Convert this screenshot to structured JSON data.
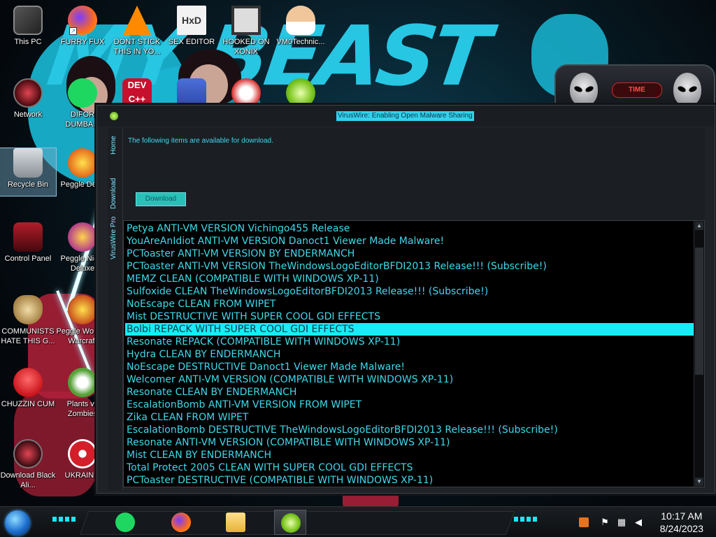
{
  "desktop": {
    "icons": [
      {
        "label": "This PC"
      },
      {
        "label": "FURRY FUX"
      },
      {
        "label": "DONT STICK THIS IN YO..."
      },
      {
        "label": "SEX EDITOR",
        "glyph": "HxD"
      },
      {
        "label": "HOOKED ON XONIX"
      },
      {
        "label": "VM0Technic..."
      },
      {
        "label": "Network"
      },
      {
        "label": "DIFOR DUMBA..."
      },
      {
        "label": "Recycle Bin"
      },
      {
        "label": "Peggle Del..."
      },
      {
        "label": "Control Panel"
      },
      {
        "label": "Peggle Nig... Deluxe"
      },
      {
        "label": "COMMUNISTS HATE THIS G..."
      },
      {
        "label": "Peggle Wo... of Warcraft"
      },
      {
        "label": "CHUZZIN CUM"
      },
      {
        "label": "Plants vs Zombies"
      },
      {
        "label": "Download Black Ali..."
      },
      {
        "label": "UKRAIN..."
      },
      {
        "glyph": "DEV C++"
      }
    ]
  },
  "wallpaper": {
    "text": "MY BEAST"
  },
  "alien_widget": {
    "time_label": "TIME"
  },
  "window": {
    "title": "VirusWire: Enabling Open Malware Sharing",
    "tabs": [
      "Home",
      "Download",
      "VirusWire Pro"
    ],
    "intro_text": "The following items are available for download.",
    "download_button": "Download",
    "selected_index": 8,
    "items": [
      "Petya ANTI-VM VERSION Vichingo455 Release",
      "YouAreAnIdiot ANTI-VM VERSION Danoct1 Viewer Made Malware!",
      "PCToaster ANTI-VM VERSION BY ENDERMANCH",
      "PCToaster ANTI-VM VERSION TheWindowsLogoEditorBFDI2013 Release!!! (Subscribe!)",
      "MEMZ CLEAN (COMPATIBLE WITH WINDOWS XP-11)",
      "Sulfoxide CLEAN TheWindowsLogoEditorBFDI2013 Release!!! (Subscribe!)",
      "NoEscape CLEAN FROM WIPET",
      "Mist DESTRUCTIVE WITH SUPER COOL GDI EFFECTS",
      "Bolbi REPACK WITH SUPER COOL GDI EFFECTS",
      "Resonate REPACK (COMPATIBLE WITH WINDOWS XP-11)",
      "Hydra CLEAN BY ENDERMANCH",
      "NoEscape DESTRUCTIVE Danoct1 Viewer Made Malware!",
      "Welcomer ANTI-VM VERSION (COMPATIBLE WITH WINDOWS XP-11)",
      "Resonate CLEAN BY ENDERMANCH",
      "EscalationBomb ANTI-VM VERSION FROM WIPET",
      "Zika CLEAN FROM WIPET",
      "EscalationBomb DESTRUCTIVE TheWindowsLogoEditorBFDI2013 Release!!! (Subscribe!)",
      "Resonate ANTI-VM VERSION (COMPATIBLE WITH WINDOWS XP-11)",
      "Mist CLEAN BY ENDERMANCH",
      "Total Protect 2005 CLEAN WITH SUPER COOL GDI EFFECTS",
      "PCToaster DESTRUCTIVE (COMPATIBLE WITH WINDOWS XP-11)"
    ]
  },
  "taskbar": {
    "apps": [
      "spotify-icon",
      "firefox-icon",
      "file-explorer-icon",
      "viruswire-lime-icon"
    ],
    "tray": [
      "fortect-icon",
      "flag-icon",
      "network-icon",
      "volume-icon"
    ],
    "time": "10:17 AM",
    "date": "8/24/2023"
  },
  "colors": {
    "accent": "#18ecf8",
    "list_text": "#3fd9ec",
    "title_highlight": "#33d1ed"
  }
}
